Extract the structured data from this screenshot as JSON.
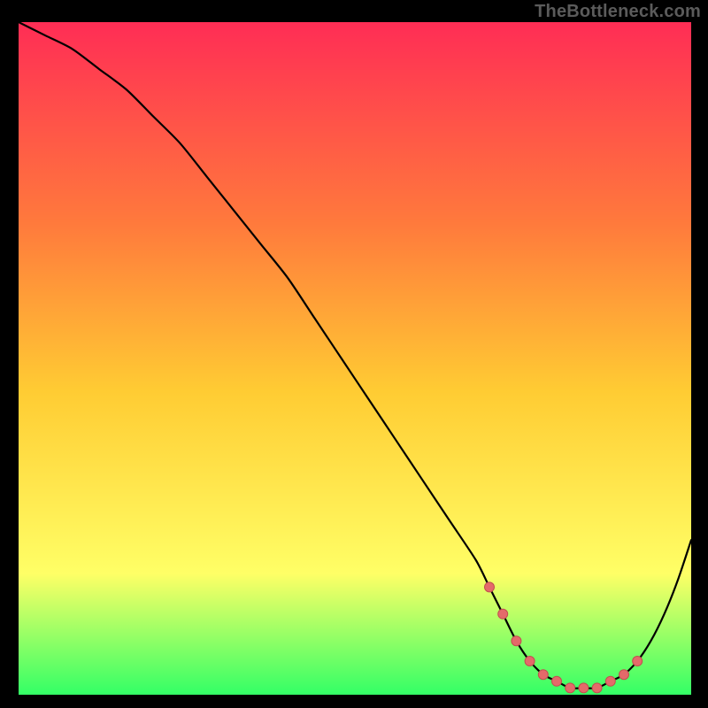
{
  "watermark": "TheBottleneck.com",
  "colors": {
    "background": "#000000",
    "gradient_top": "#ff2d55",
    "gradient_mid_upper": "#ff7a3c",
    "gradient_mid": "#ffcc33",
    "gradient_mid_lower": "#ffff66",
    "gradient_bottom": "#33ff66",
    "curve": "#000000",
    "marker": "#e46a6a",
    "marker_stroke": "#c24f4f"
  },
  "chart_data": {
    "type": "line",
    "title": "",
    "xlabel": "",
    "ylabel": "",
    "xlim": [
      0,
      100
    ],
    "ylim": [
      0,
      100
    ],
    "series": [
      {
        "name": "bottleneck-curve",
        "x": [
          0,
          4,
          8,
          12,
          16,
          20,
          24,
          28,
          32,
          36,
          40,
          44,
          48,
          52,
          56,
          60,
          64,
          68,
          70,
          72,
          74,
          76,
          78,
          80,
          82,
          84,
          86,
          88,
          90,
          92,
          94,
          96,
          98,
          100
        ],
        "y": [
          100,
          98,
          96,
          93,
          90,
          86,
          82,
          77,
          72,
          67,
          62,
          56,
          50,
          44,
          38,
          32,
          26,
          20,
          16,
          12,
          8,
          5,
          3,
          2,
          1,
          1,
          1,
          2,
          3,
          5,
          8,
          12,
          17,
          23
        ]
      }
    ],
    "markers": {
      "name": "highlight-points",
      "x": [
        70,
        72,
        74,
        76,
        78,
        80,
        82,
        84,
        86,
        88,
        90,
        92
      ],
      "y": [
        16,
        12,
        8,
        5,
        3,
        2,
        1,
        1,
        1,
        2,
        3,
        5
      ]
    },
    "legend": false,
    "grid": false
  }
}
